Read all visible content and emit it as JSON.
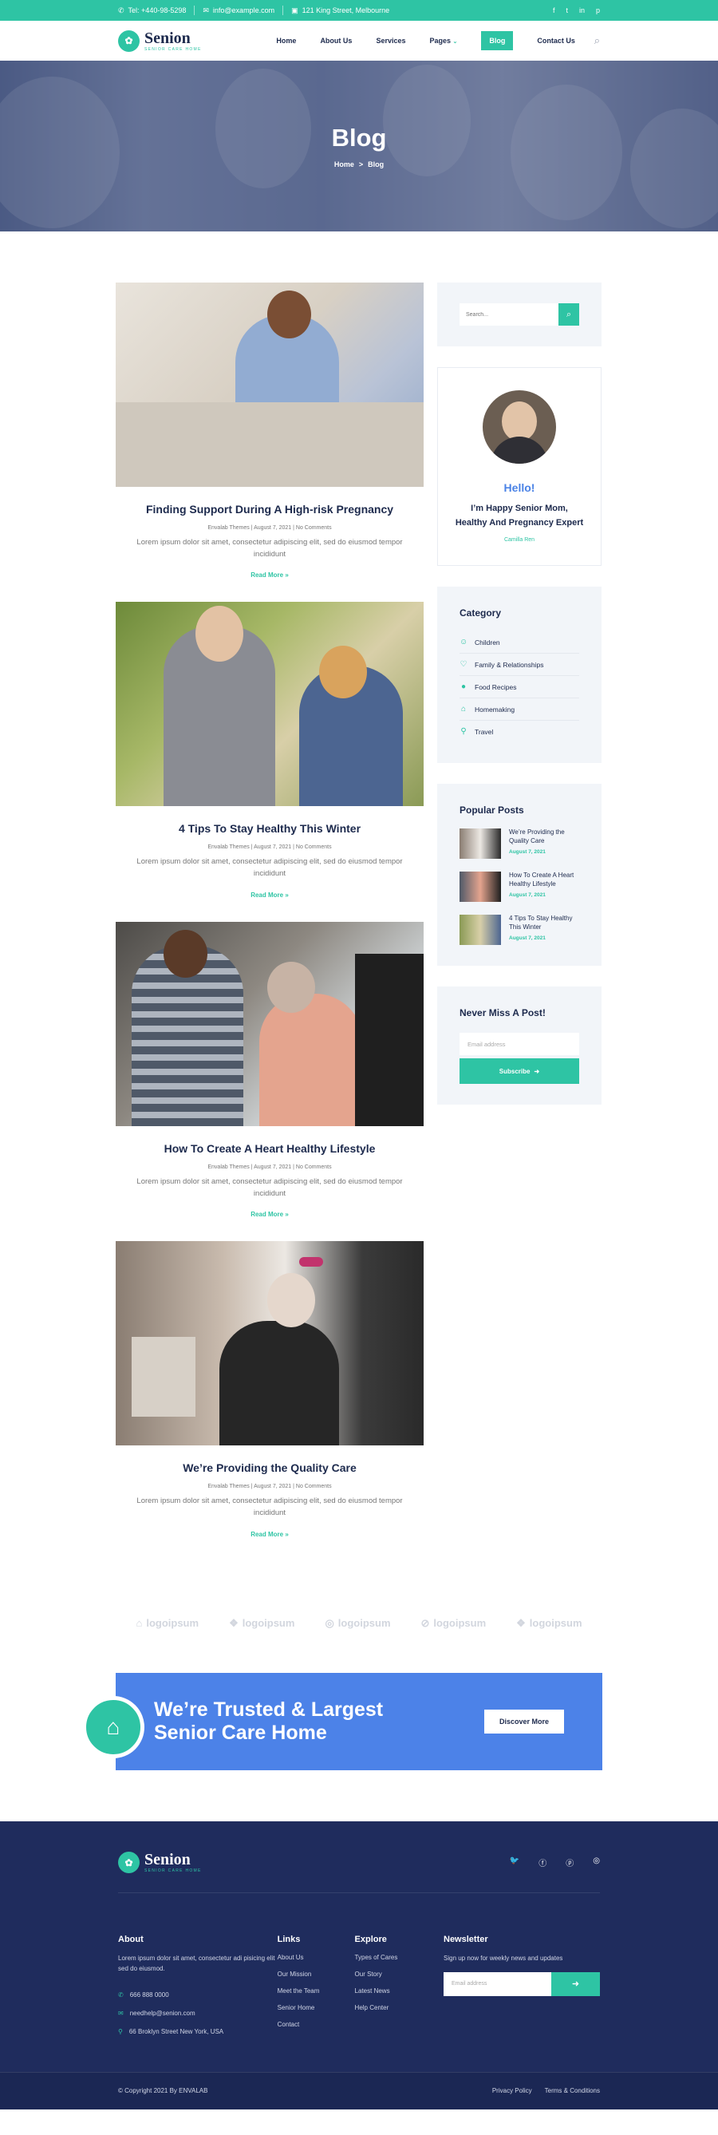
{
  "topbar": {
    "phone": "Tel: +440-98-5298",
    "email": "info@example.com",
    "address": "121 King Street, Melbourne",
    "social": [
      "f",
      "t",
      "in",
      "p"
    ]
  },
  "nav": {
    "brand": "Senion",
    "brand_tagline": "SENIOR CARE HOME",
    "items": [
      "Home",
      "About Us",
      "Services",
      "Pages",
      "Blog",
      "Contact Us"
    ]
  },
  "hero": {
    "title": "Blog",
    "crumb_home": "Home",
    "crumb_sep": ">",
    "crumb_current": "Blog"
  },
  "posts": [
    {
      "title": "Finding Support During A High-risk Pregnancy",
      "meta": "Envalab Themes | August 7, 2021 | No Comments",
      "excerpt": "Lorem ipsum dolor sit amet, consectetur adipiscing elit, sed do eiusmod tempor incididunt",
      "read_more": "Read More »"
    },
    {
      "title": "4 Tips To Stay Healthy This Winter",
      "meta": "Envalab Themes | August 7, 2021 | No Comments",
      "excerpt": "Lorem ipsum dolor sit amet, consectetur adipiscing elit, sed do eiusmod tempor incididunt",
      "read_more": "Read More »"
    },
    {
      "title": "How To Create A Heart Healthy Lifestyle",
      "meta": "Envalab Themes | August 7, 2021 | No Comments",
      "excerpt": "Lorem ipsum dolor sit amet, consectetur adipiscing elit, sed do eiusmod tempor incididunt",
      "read_more": "Read More »"
    },
    {
      "title": "We’re Providing the Quality Care",
      "meta": "Envalab Themes | August 7, 2021 | No Comments",
      "excerpt": "Lorem ipsum dolor sit amet, consectetur adipiscing elit, sed do eiusmod tempor incididunt",
      "read_more": "Read More »"
    }
  ],
  "sidebar": {
    "search_placeholder": "Search...",
    "author": {
      "hello": "Hello!",
      "bio": "I’m Happy Senior Mom, Healthy And Pregnancy Expert",
      "name": "Camilla Ren"
    },
    "category_title": "Category",
    "categories": [
      "Children",
      "Family & Relationships",
      "Food Recipes",
      "Homemaking",
      "Travel"
    ],
    "popular_title": "Popular Posts",
    "popular": [
      {
        "title": "We’re Providing the Quality Care",
        "date": "August 7, 2021"
      },
      {
        "title": "How To Create A Heart Healthy Lifestyle",
        "date": "August 7, 2021"
      },
      {
        "title": "4 Tips To Stay Healthy This Winter",
        "date": "August 7, 2021"
      }
    ],
    "newsletter_title": "Never Miss A Post!",
    "newsletter_placeholder": "Email address",
    "newsletter_button": "Subscribe"
  },
  "logos": [
    "logoipsum",
    "logoipsum",
    "logoipsum",
    "logoipsum",
    "logoipsum"
  ],
  "cta": {
    "title": "We’re Trusted & Largest Senior Care Home",
    "button": "Discover More"
  },
  "footer": {
    "about_title": "About",
    "about_text": "Lorem ipsum dolor sit amet, consectetur adi pisicing elit sed do eiusmod.",
    "phone": "666 888 0000",
    "email": "needhelp@senion.com",
    "address": "66 Broklyn Street New York, USA",
    "links_title": "Links",
    "links": [
      "About Us",
      "Our Mission",
      "Meet the Team",
      "Senior Home",
      "Contact"
    ],
    "explore_title": "Explore",
    "explore": [
      "Types of Cares",
      "Our Story",
      "Latest News",
      "Help Center"
    ],
    "newsletter_title": "Newsletter",
    "newsletter_text": "Sign up now for weekly news and updates",
    "newsletter_placeholder": "Email address",
    "copyright": "© Copyright 2021 By ENVALAB",
    "privacy": "Privacy Policy",
    "terms": "Terms & Conditions"
  },
  "colors": {
    "accent": "#2ec4a4",
    "navy": "#1f2c5d",
    "blue": "#4c82e8"
  }
}
